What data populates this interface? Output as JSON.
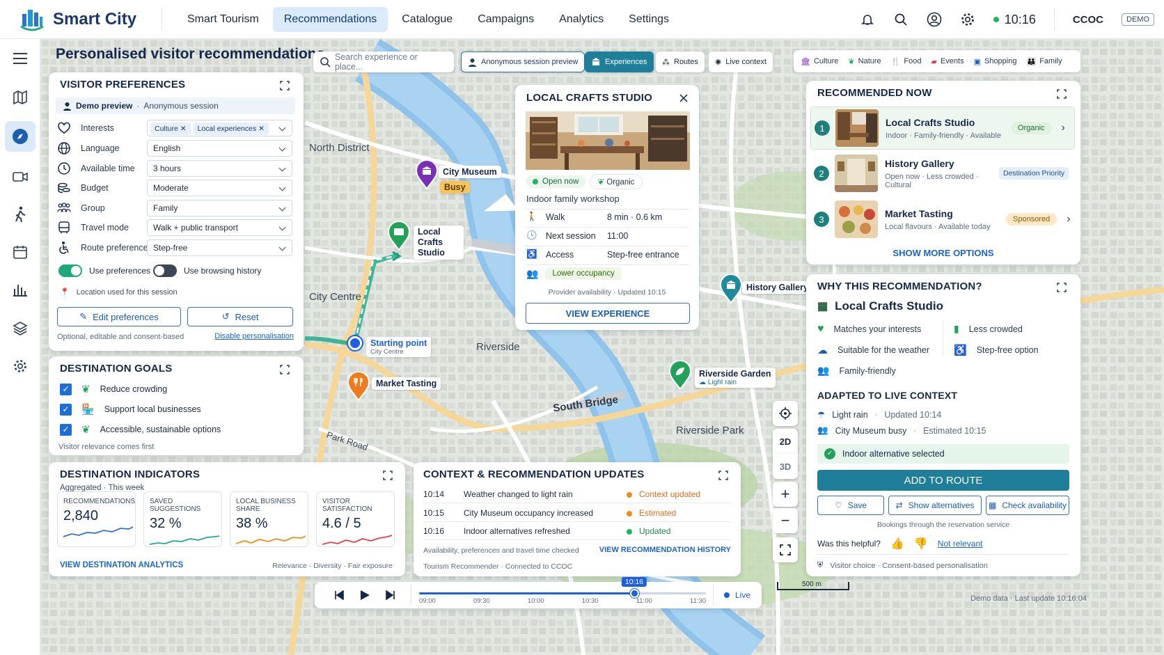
{
  "app": {
    "title": "Smart City",
    "time": "10:16",
    "org": "CCOC",
    "demo_badge": "DEMO"
  },
  "nav": [
    "Smart Tourism",
    "Recommendations",
    "Catalogue",
    "Campaigns",
    "Analytics",
    "Settings"
  ],
  "page_title": "Personalised visitor recommendations",
  "search": {
    "placeholder": "Search experience or place..."
  },
  "session_btn": "Anonymous session preview",
  "view_tabs": [
    "Experiences",
    "Routes",
    "Live context"
  ],
  "categories": [
    "Culture",
    "Nature",
    "Food",
    "Events",
    "Shopping",
    "Family"
  ],
  "prefs": {
    "title": "VISITOR PREFERENCES",
    "demo": "Demo preview",
    "session": "Anonymous session",
    "rows": [
      {
        "label": "Interests",
        "chips": [
          "Culture",
          "Local experiences"
        ]
      },
      {
        "label": "Language",
        "value": "English"
      },
      {
        "label": "Available time",
        "value": "3 hours"
      },
      {
        "label": "Budget",
        "value": "Moderate"
      },
      {
        "label": "Group",
        "value": "Family"
      },
      {
        "label": "Travel mode",
        "value": "Walk + public transport"
      },
      {
        "label": "Route preference",
        "value": "Step-free"
      }
    ],
    "toggle1": "Use preferences",
    "toggle2": "Use browsing history",
    "location": "Location used for this session",
    "edit": "Edit preferences",
    "reset": "Reset",
    "footer": "Optional, editable and consent-based",
    "disable": "Disable personalisation"
  },
  "goals": {
    "title": "DESTINATION GOALS",
    "items": [
      "Reduce crowding",
      "Support local businesses",
      "Accessible, sustainable options"
    ],
    "footer": "Visitor relevance comes first"
  },
  "indicators": {
    "title": "DESTINATION INDICATORS",
    "sub1": "Aggregated",
    "sub2": "This week",
    "kpis": [
      {
        "label": "RECOMMENDATIONS",
        "value": "2,840",
        "color": "#2f6fd6"
      },
      {
        "label": "SAVED SUGGESTIONS",
        "value": "32 %",
        "color": "#1fa39a"
      },
      {
        "label": "LOCAL BUSINESS SHARE",
        "value": "38 %",
        "color": "#f08a24"
      },
      {
        "label": "VISITOR SATISFACTION",
        "value": "4.6 / 5",
        "color": "#e0404a"
      }
    ],
    "link": "VIEW DESTINATION ANALYTICS",
    "footer": "Relevance · Diversity · Fair exposure"
  },
  "updates": {
    "title": "CONTEXT & RECOMMENDATION UPDATES",
    "rows": [
      {
        "time": "10:14",
        "text": "Weather changed to light rain",
        "status": "Context updated",
        "color": "#f08a24"
      },
      {
        "time": "10:15",
        "text": "City Museum occupancy increased",
        "status": "Estimated",
        "color": "#f08a24"
      },
      {
        "time": "10:16",
        "text": "Indoor alternatives refreshed",
        "status": "Updated",
        "color": "#22b35e"
      }
    ],
    "note": "Availability, preferences and travel time checked",
    "link": "VIEW RECOMMENDATION HISTORY",
    "footer": "Tourism Recommender · Connected to CCOC"
  },
  "popup": {
    "title": "LOCAL CRAFTS STUDIO",
    "open": "Open now",
    "organic": "Organic",
    "desc": "Indoor family workshop",
    "rows": [
      {
        "k": "Walk",
        "v": "8 min · 0.6 km"
      },
      {
        "k": "Next session",
        "v": "11:00"
      },
      {
        "k": "Access",
        "v": "Step-free entrance"
      }
    ],
    "occupancy": "Lower occupancy",
    "availability": "Provider availability · Updated 10:15",
    "cta": "VIEW EXPERIENCE"
  },
  "map_labels": {
    "north": "North District",
    "centre": "City Centre",
    "riverside": "Riverside",
    "south_bridge": "South Bridge",
    "riverside_park": "Riverside Park",
    "park_road": "Park Road",
    "museum": "City Museum",
    "busy": "Busy",
    "crafts": "Local Crafts Studio",
    "start": "Starting point",
    "start_sub": "City Centre",
    "market": "Market Tasting",
    "gallery": "History Gallery",
    "garden": "Riverside Garden",
    "rain": "Light rain"
  },
  "map_controls": {
    "d2": "2D",
    "d3": "3D"
  },
  "timeline": {
    "current": "10:16",
    "ticks": [
      "09:00",
      "09:30",
      "10:00",
      "10:30",
      "11:00",
      "11:30"
    ],
    "live": "Live",
    "progress": 0.75
  },
  "scale": "500 m",
  "status": "Demo data · Last update 10:16:04",
  "recommended": {
    "title": "RECOMMENDED NOW",
    "items": [
      {
        "n": "1",
        "name": "Local Crafts Studio",
        "meta": "Indoor · Family-friendly · Available",
        "badge": "Organic"
      },
      {
        "n": "2",
        "name": "History Gallery",
        "meta": "Open now · Less crowded · Cultural",
        "badge": "Destination Priority"
      },
      {
        "n": "3",
        "name": "Market Tasting",
        "meta": "Local flavours · Available today",
        "badge": "Sponsored"
      }
    ],
    "more": "SHOW MORE OPTIONS"
  },
  "why": {
    "title": "WHY THIS RECOMMENDATION?",
    "place": "Local Crafts Studio",
    "reasons": [
      "Matches your interests",
      "Less crowded",
      "Suitable for the weather",
      "Step-free option",
      "Family-friendly"
    ],
    "adapted_title": "ADAPTED TO LIVE CONTEXT",
    "ctx1a": "Light rain",
    "ctx1b": "Updated 10:14",
    "ctx2a": "City Museum busy",
    "ctx2b": "Estimated 10:15",
    "selected": "Indoor alternative selected",
    "add": "ADD TO ROUTE",
    "save": "Save",
    "alts": "Show alternatives",
    "check": "Check availability",
    "bookings": "Bookings through the reservation service",
    "helpful": "Was this helpful?",
    "not_relevant": "Not relevant",
    "footer": "Visitor choice · Consent-based personalisation"
  }
}
